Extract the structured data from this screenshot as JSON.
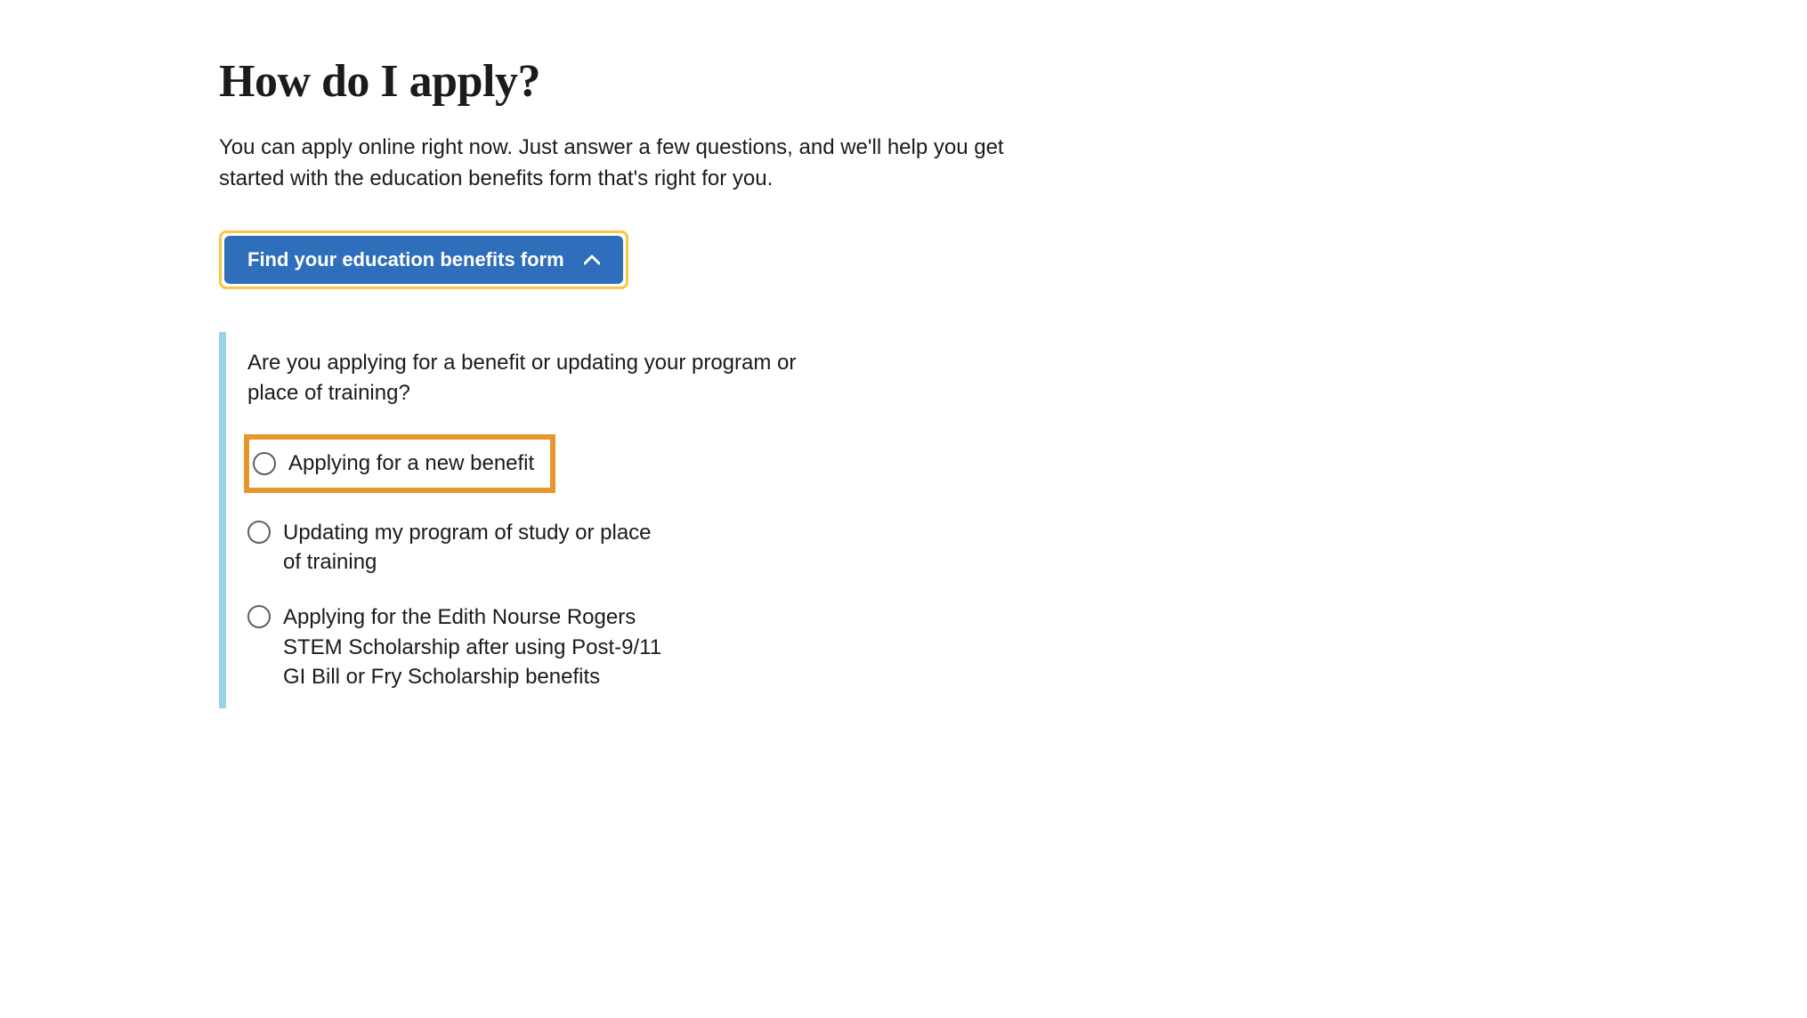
{
  "heading": "How do I apply?",
  "intro": "You can apply online right now. Just answer a few questions, and we'll help you get started with the education benefits form that's right for you.",
  "cta": {
    "label": "Find your education benefits form"
  },
  "question": {
    "prompt": "Are you applying for a benefit or updating your program or place of training?",
    "options": [
      {
        "label": "Applying for a new benefit",
        "highlighted": true
      },
      {
        "label": "Updating my program of study or place of training",
        "highlighted": false
      },
      {
        "label": "Applying for the Edith Nourse Rogers STEM Scholarship after using Post-9/11 GI Bill or Fry Scholarship benefits",
        "highlighted": false
      }
    ]
  },
  "colors": {
    "button_bg": "#2e6ebb",
    "focus_ring": "#f9c642",
    "highlight_border": "#e8972e",
    "question_border": "#99d2eb"
  }
}
